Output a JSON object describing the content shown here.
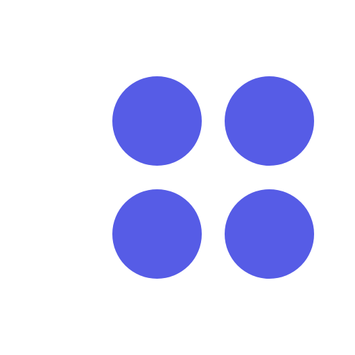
{
  "icon": {
    "name": "four-dots-grid-icon",
    "color": "#565CE6",
    "dots": [
      {
        "name": "dot-top-left"
      },
      {
        "name": "dot-top-right"
      },
      {
        "name": "dot-bottom-left"
      },
      {
        "name": "dot-bottom-right"
      }
    ]
  },
  "background": "#FFFFFF"
}
